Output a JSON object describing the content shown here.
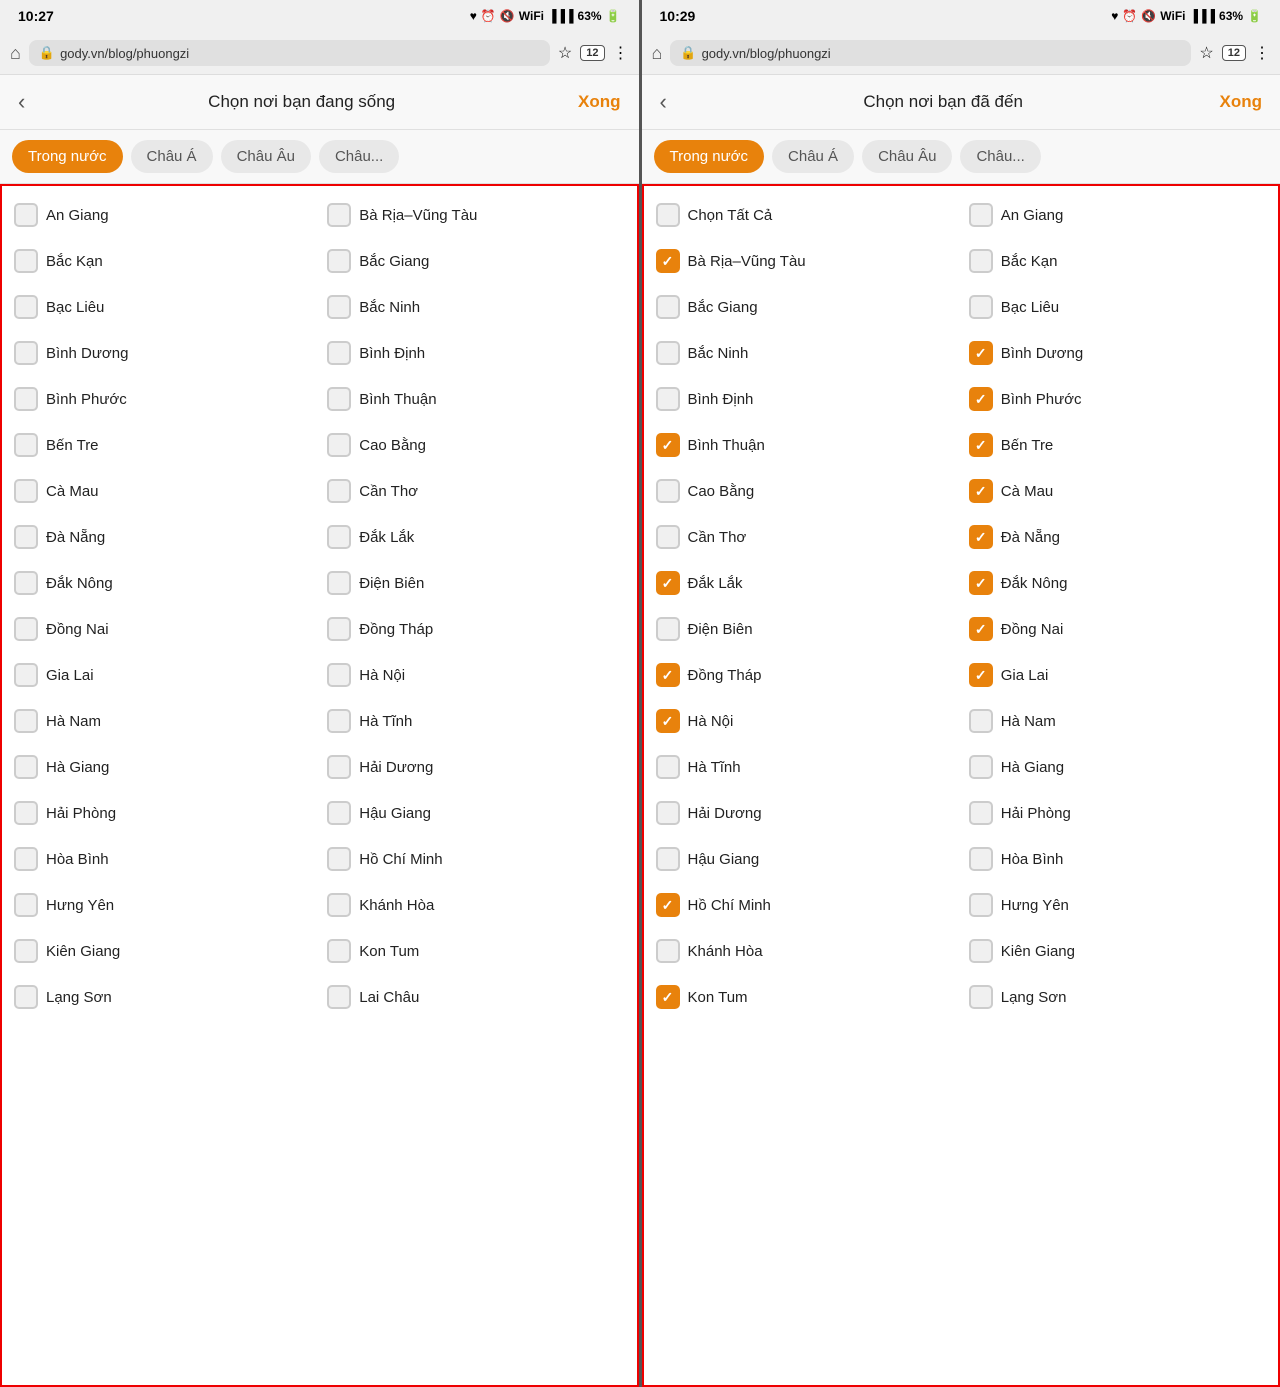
{
  "phone1": {
    "statusBar": {
      "time": "10:27",
      "batteryPercent": "63%"
    },
    "browserBar": {
      "url": "gody.vn/blog/phuongzi",
      "tabCount": "12"
    },
    "header": {
      "title": "Chọn nơi bạn đang sống",
      "done": "Xong"
    },
    "tabs": [
      {
        "label": "Trong nước",
        "active": true
      },
      {
        "label": "Châu Á",
        "active": false
      },
      {
        "label": "Châu Âu",
        "active": false
      },
      {
        "label": "Châu",
        "active": false
      }
    ],
    "items": [
      {
        "label": "An Giang",
        "checked": false
      },
      {
        "label": "Bà Rịa–Vũng Tàu",
        "checked": false
      },
      {
        "label": "Bắc Kạn",
        "checked": false
      },
      {
        "label": "Bắc Giang",
        "checked": false
      },
      {
        "label": "Bạc Liêu",
        "checked": false
      },
      {
        "label": "Bắc Ninh",
        "checked": false
      },
      {
        "label": "Bình Dương",
        "checked": false
      },
      {
        "label": "Bình Định",
        "checked": false
      },
      {
        "label": "Bình Phước",
        "checked": false
      },
      {
        "label": "Bình Thuận",
        "checked": false
      },
      {
        "label": "Bến Tre",
        "checked": false
      },
      {
        "label": "Cao Bằng",
        "checked": false
      },
      {
        "label": "Cà Mau",
        "checked": false
      },
      {
        "label": "Cần Thơ",
        "checked": false
      },
      {
        "label": "Đà Nẵng",
        "checked": false
      },
      {
        "label": "Đắk Lắk",
        "checked": false
      },
      {
        "label": "Đắk Nông",
        "checked": false
      },
      {
        "label": "Điện Biên",
        "checked": false
      },
      {
        "label": "Đồng Nai",
        "checked": false
      },
      {
        "label": "Đồng Tháp",
        "checked": false
      },
      {
        "label": "Gia Lai",
        "checked": false
      },
      {
        "label": "Hà Nội",
        "checked": false
      },
      {
        "label": "Hà Nam",
        "checked": false
      },
      {
        "label": "Hà Tĩnh",
        "checked": false
      },
      {
        "label": "Hà Giang",
        "checked": false
      },
      {
        "label": "Hải Dương",
        "checked": false
      },
      {
        "label": "Hải Phòng",
        "checked": false
      },
      {
        "label": "Hậu Giang",
        "checked": false
      },
      {
        "label": "Hòa Bình",
        "checked": false
      },
      {
        "label": "Hồ Chí Minh",
        "checked": false
      },
      {
        "label": "Hưng Yên",
        "checked": false
      },
      {
        "label": "Khánh Hòa",
        "checked": false
      },
      {
        "label": "Kiên Giang",
        "checked": false
      },
      {
        "label": "Kon Tum",
        "checked": false
      },
      {
        "label": "Lạng Sơn",
        "checked": false
      },
      {
        "label": "Lai Châu",
        "checked": false
      }
    ]
  },
  "phone2": {
    "statusBar": {
      "time": "10:29",
      "batteryPercent": "63%"
    },
    "browserBar": {
      "url": "gody.vn/blog/phuongzi",
      "tabCount": "12"
    },
    "header": {
      "title": "Chọn nơi bạn đã đến",
      "done": "Xong"
    },
    "tabs": [
      {
        "label": "Trong nước",
        "active": true
      },
      {
        "label": "Châu Á",
        "active": false
      },
      {
        "label": "Châu Âu",
        "active": false
      },
      {
        "label": "Châu",
        "active": false
      }
    ],
    "items": [
      {
        "label": "Chọn Tất Cả",
        "checked": false
      },
      {
        "label": "An Giang",
        "checked": false
      },
      {
        "label": "Bà Rịa–Vũng Tàu",
        "checked": true
      },
      {
        "label": "Bắc Kạn",
        "checked": false
      },
      {
        "label": "Bắc Giang",
        "checked": false
      },
      {
        "label": "Bạc Liêu",
        "checked": false
      },
      {
        "label": "Bắc Ninh",
        "checked": false
      },
      {
        "label": "Bình Dương",
        "checked": true
      },
      {
        "label": "Bình Định",
        "checked": false
      },
      {
        "label": "Bình Phước",
        "checked": true
      },
      {
        "label": "Bình Thuận",
        "checked": true
      },
      {
        "label": "Bến Tre",
        "checked": true
      },
      {
        "label": "Cao Bằng",
        "checked": false
      },
      {
        "label": "Cà Mau",
        "checked": true
      },
      {
        "label": "Cần Thơ",
        "checked": false
      },
      {
        "label": "Đà Nẵng",
        "checked": true
      },
      {
        "label": "Đắk Lắk",
        "checked": true
      },
      {
        "label": "Đắk Nông",
        "checked": true
      },
      {
        "label": "Điện Biên",
        "checked": false
      },
      {
        "label": "Đồng Nai",
        "checked": true
      },
      {
        "label": "Đồng Tháp",
        "checked": true
      },
      {
        "label": "Gia Lai",
        "checked": true
      },
      {
        "label": "Hà Nội",
        "checked": true
      },
      {
        "label": "Hà Nam",
        "checked": false
      },
      {
        "label": "Hà Tĩnh",
        "checked": false
      },
      {
        "label": "Hà Giang",
        "checked": false
      },
      {
        "label": "Hải Dương",
        "checked": false
      },
      {
        "label": "Hải Phòng",
        "checked": false
      },
      {
        "label": "Hậu Giang",
        "checked": false
      },
      {
        "label": "Hòa Bình",
        "checked": false
      },
      {
        "label": "Hồ Chí Minh",
        "checked": true
      },
      {
        "label": "Hưng Yên",
        "checked": false
      },
      {
        "label": "Khánh Hòa",
        "checked": false
      },
      {
        "label": "Kiên Giang",
        "checked": false
      },
      {
        "label": "Kon Tum",
        "checked": true
      },
      {
        "label": "Lạng Sơn",
        "checked": false
      }
    ]
  }
}
